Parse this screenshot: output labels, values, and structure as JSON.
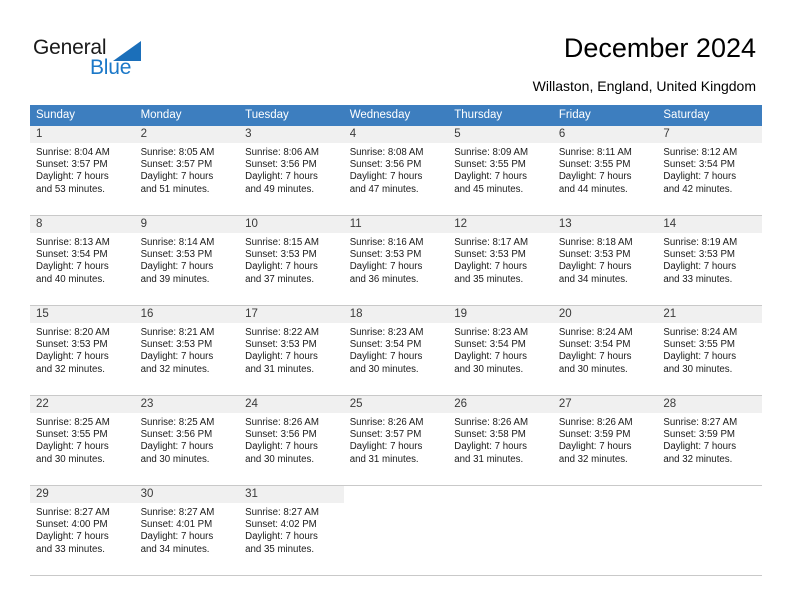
{
  "brand": {
    "name_part1": "General",
    "name_part2": "Blue",
    "accent_color": "#1b78c8"
  },
  "header": {
    "title": "December 2024",
    "location": "Willaston, England, United Kingdom"
  },
  "calendar": {
    "header_bg": "#3d7ebf",
    "weekdays": [
      "Sunday",
      "Monday",
      "Tuesday",
      "Wednesday",
      "Thursday",
      "Friday",
      "Saturday"
    ],
    "weeks": [
      [
        {
          "day": "1",
          "sunrise": "Sunrise: 8:04 AM",
          "sunset": "Sunset: 3:57 PM",
          "daylight_line1": "Daylight: 7 hours",
          "daylight_line2": "and 53 minutes."
        },
        {
          "day": "2",
          "sunrise": "Sunrise: 8:05 AM",
          "sunset": "Sunset: 3:57 PM",
          "daylight_line1": "Daylight: 7 hours",
          "daylight_line2": "and 51 minutes."
        },
        {
          "day": "3",
          "sunrise": "Sunrise: 8:06 AM",
          "sunset": "Sunset: 3:56 PM",
          "daylight_line1": "Daylight: 7 hours",
          "daylight_line2": "and 49 minutes."
        },
        {
          "day": "4",
          "sunrise": "Sunrise: 8:08 AM",
          "sunset": "Sunset: 3:56 PM",
          "daylight_line1": "Daylight: 7 hours",
          "daylight_line2": "and 47 minutes."
        },
        {
          "day": "5",
          "sunrise": "Sunrise: 8:09 AM",
          "sunset": "Sunset: 3:55 PM",
          "daylight_line1": "Daylight: 7 hours",
          "daylight_line2": "and 45 minutes."
        },
        {
          "day": "6",
          "sunrise": "Sunrise: 8:11 AM",
          "sunset": "Sunset: 3:55 PM",
          "daylight_line1": "Daylight: 7 hours",
          "daylight_line2": "and 44 minutes."
        },
        {
          "day": "7",
          "sunrise": "Sunrise: 8:12 AM",
          "sunset": "Sunset: 3:54 PM",
          "daylight_line1": "Daylight: 7 hours",
          "daylight_line2": "and 42 minutes."
        }
      ],
      [
        {
          "day": "8",
          "sunrise": "Sunrise: 8:13 AM",
          "sunset": "Sunset: 3:54 PM",
          "daylight_line1": "Daylight: 7 hours",
          "daylight_line2": "and 40 minutes."
        },
        {
          "day": "9",
          "sunrise": "Sunrise: 8:14 AM",
          "sunset": "Sunset: 3:53 PM",
          "daylight_line1": "Daylight: 7 hours",
          "daylight_line2": "and 39 minutes."
        },
        {
          "day": "10",
          "sunrise": "Sunrise: 8:15 AM",
          "sunset": "Sunset: 3:53 PM",
          "daylight_line1": "Daylight: 7 hours",
          "daylight_line2": "and 37 minutes."
        },
        {
          "day": "11",
          "sunrise": "Sunrise: 8:16 AM",
          "sunset": "Sunset: 3:53 PM",
          "daylight_line1": "Daylight: 7 hours",
          "daylight_line2": "and 36 minutes."
        },
        {
          "day": "12",
          "sunrise": "Sunrise: 8:17 AM",
          "sunset": "Sunset: 3:53 PM",
          "daylight_line1": "Daylight: 7 hours",
          "daylight_line2": "and 35 minutes."
        },
        {
          "day": "13",
          "sunrise": "Sunrise: 8:18 AM",
          "sunset": "Sunset: 3:53 PM",
          "daylight_line1": "Daylight: 7 hours",
          "daylight_line2": "and 34 minutes."
        },
        {
          "day": "14",
          "sunrise": "Sunrise: 8:19 AM",
          "sunset": "Sunset: 3:53 PM",
          "daylight_line1": "Daylight: 7 hours",
          "daylight_line2": "and 33 minutes."
        }
      ],
      [
        {
          "day": "15",
          "sunrise": "Sunrise: 8:20 AM",
          "sunset": "Sunset: 3:53 PM",
          "daylight_line1": "Daylight: 7 hours",
          "daylight_line2": "and 32 minutes."
        },
        {
          "day": "16",
          "sunrise": "Sunrise: 8:21 AM",
          "sunset": "Sunset: 3:53 PM",
          "daylight_line1": "Daylight: 7 hours",
          "daylight_line2": "and 32 minutes."
        },
        {
          "day": "17",
          "sunrise": "Sunrise: 8:22 AM",
          "sunset": "Sunset: 3:53 PM",
          "daylight_line1": "Daylight: 7 hours",
          "daylight_line2": "and 31 minutes."
        },
        {
          "day": "18",
          "sunrise": "Sunrise: 8:23 AM",
          "sunset": "Sunset: 3:54 PM",
          "daylight_line1": "Daylight: 7 hours",
          "daylight_line2": "and 30 minutes."
        },
        {
          "day": "19",
          "sunrise": "Sunrise: 8:23 AM",
          "sunset": "Sunset: 3:54 PM",
          "daylight_line1": "Daylight: 7 hours",
          "daylight_line2": "and 30 minutes."
        },
        {
          "day": "20",
          "sunrise": "Sunrise: 8:24 AM",
          "sunset": "Sunset: 3:54 PM",
          "daylight_line1": "Daylight: 7 hours",
          "daylight_line2": "and 30 minutes."
        },
        {
          "day": "21",
          "sunrise": "Sunrise: 8:24 AM",
          "sunset": "Sunset: 3:55 PM",
          "daylight_line1": "Daylight: 7 hours",
          "daylight_line2": "and 30 minutes."
        }
      ],
      [
        {
          "day": "22",
          "sunrise": "Sunrise: 8:25 AM",
          "sunset": "Sunset: 3:55 PM",
          "daylight_line1": "Daylight: 7 hours",
          "daylight_line2": "and 30 minutes."
        },
        {
          "day": "23",
          "sunrise": "Sunrise: 8:25 AM",
          "sunset": "Sunset: 3:56 PM",
          "daylight_line1": "Daylight: 7 hours",
          "daylight_line2": "and 30 minutes."
        },
        {
          "day": "24",
          "sunrise": "Sunrise: 8:26 AM",
          "sunset": "Sunset: 3:56 PM",
          "daylight_line1": "Daylight: 7 hours",
          "daylight_line2": "and 30 minutes."
        },
        {
          "day": "25",
          "sunrise": "Sunrise: 8:26 AM",
          "sunset": "Sunset: 3:57 PM",
          "daylight_line1": "Daylight: 7 hours",
          "daylight_line2": "and 31 minutes."
        },
        {
          "day": "26",
          "sunrise": "Sunrise: 8:26 AM",
          "sunset": "Sunset: 3:58 PM",
          "daylight_line1": "Daylight: 7 hours",
          "daylight_line2": "and 31 minutes."
        },
        {
          "day": "27",
          "sunrise": "Sunrise: 8:26 AM",
          "sunset": "Sunset: 3:59 PM",
          "daylight_line1": "Daylight: 7 hours",
          "daylight_line2": "and 32 minutes."
        },
        {
          "day": "28",
          "sunrise": "Sunrise: 8:27 AM",
          "sunset": "Sunset: 3:59 PM",
          "daylight_line1": "Daylight: 7 hours",
          "daylight_line2": "and 32 minutes."
        }
      ],
      [
        {
          "day": "29",
          "sunrise": "Sunrise: 8:27 AM",
          "sunset": "Sunset: 4:00 PM",
          "daylight_line1": "Daylight: 7 hours",
          "daylight_line2": "and 33 minutes."
        },
        {
          "day": "30",
          "sunrise": "Sunrise: 8:27 AM",
          "sunset": "Sunset: 4:01 PM",
          "daylight_line1": "Daylight: 7 hours",
          "daylight_line2": "and 34 minutes."
        },
        {
          "day": "31",
          "sunrise": "Sunrise: 8:27 AM",
          "sunset": "Sunset: 4:02 PM",
          "daylight_line1": "Daylight: 7 hours",
          "daylight_line2": "and 35 minutes."
        },
        {
          "day": "",
          "sunrise": "",
          "sunset": "",
          "daylight_line1": "",
          "daylight_line2": ""
        },
        {
          "day": "",
          "sunrise": "",
          "sunset": "",
          "daylight_line1": "",
          "daylight_line2": ""
        },
        {
          "day": "",
          "sunrise": "",
          "sunset": "",
          "daylight_line1": "",
          "daylight_line2": ""
        },
        {
          "day": "",
          "sunrise": "",
          "sunset": "",
          "daylight_line1": "",
          "daylight_line2": ""
        }
      ]
    ]
  }
}
